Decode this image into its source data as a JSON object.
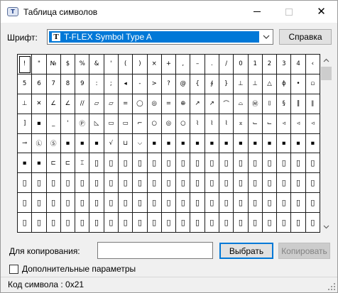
{
  "window": {
    "title": "Таблица символов",
    "icon": "app-symbol-icon"
  },
  "font": {
    "label": "Шрифт:",
    "value": "T-FLEX Symbol Type A",
    "icon_letter": "T"
  },
  "buttons": {
    "help": "Справка",
    "select": "Выбрать",
    "copy": "Копировать"
  },
  "copy_field": {
    "label": "Для копирования:",
    "value": ""
  },
  "options": {
    "label": "Дополнительные параметры",
    "checked": false
  },
  "status": {
    "text": "Код символа : 0x21"
  },
  "grid": {
    "columns": 21,
    "rows": [
      [
        "!",
        "\"",
        "№",
        "$",
        "%",
        "&",
        "'",
        "(",
        ")",
        "×",
        "+",
        ",",
        "–",
        ".",
        "/",
        "0",
        "1",
        "2",
        "3",
        "4",
        "‹"
      ],
      [
        "5",
        "6",
        "7",
        "8",
        "9",
        ":",
        ";",
        "◂",
        "-",
        ">",
        "?",
        "@",
        "{",
        "∮",
        "}",
        "⊥",
        "⊥",
        "△",
        "ɸ",
        "•",
        "▫"
      ],
      [
        "⊥",
        "✕",
        "∠",
        "∠",
        "//",
        "▱",
        "▱",
        "=",
        "◯",
        "◎",
        "=",
        "⊕",
        "↗",
        "↗",
        "⌒",
        "⌓",
        "Ⓜ",
        "⌷",
        "§",
        "‖",
        "∥"
      ],
      [
        "]",
        "▪",
        "_",
        "'",
        "Ⓟ",
        "◺",
        "▭",
        "▭",
        "⌐",
        "○",
        "◎",
        "○",
        "⌇",
        "⌇",
        "⌇",
        "⌅",
        "⌙",
        "⌙",
        "◃",
        "◃",
        "◃"
      ],
      [
        "⊸",
        "Ⓛ",
        "Ⓢ",
        "▪",
        "▪",
        "▪",
        "√",
        "⊔",
        "⌵",
        "▪",
        "▪",
        "▪",
        "▪",
        "▪",
        "▪",
        "▪",
        "▪",
        "▪",
        "▪",
        "▪",
        "▪"
      ],
      [
        "▪",
        "▪",
        "⊏",
        "⊏",
        "⌶",
        "▯",
        "▯",
        "▯",
        "▯",
        "▯",
        "▯",
        "▯",
        "▯",
        "▯",
        "▯",
        "▯",
        "▯",
        "▯",
        "▯",
        "▯",
        "▯"
      ],
      [
        "▯",
        "▯",
        "▯",
        "▯",
        "▯",
        "▯",
        "▯",
        "▯",
        "▯",
        "▯",
        "▯",
        "▯",
        "▯",
        "▯",
        "▯",
        "▯",
        "▯",
        "▯",
        "▯",
        "▯",
        "▯"
      ],
      [
        "▯",
        "▯",
        "▯",
        "▯",
        "▯",
        "▯",
        "▯",
        "▯",
        "▯",
        "▯",
        "▯",
        "▯",
        "▯",
        "▯",
        "▯",
        "▯",
        "▯",
        "▯",
        "▯",
        "▯",
        "▯"
      ],
      [
        "▯",
        "▯",
        "▯",
        "▯",
        "▯",
        "▯",
        "▯",
        "▯",
        "▯",
        "▯",
        "▯",
        "▯",
        "▯",
        "▯",
        "▯",
        "▯",
        "▯",
        "▯",
        "▯",
        "▯",
        "▯"
      ]
    ],
    "selected": 0
  },
  "colors": {
    "accent": "#0078d7",
    "grid_line": "#1a1a1a",
    "window_bg": "#f0f0f0"
  },
  "icons": {
    "minimize": "minimize-icon",
    "maximize": "maximize-icon",
    "close": "close-icon",
    "dropdown": "chevron-down-icon",
    "scroll_up": "scroll-up-icon",
    "scroll_down": "scroll-down-icon",
    "grip": "size-grip-icon"
  }
}
